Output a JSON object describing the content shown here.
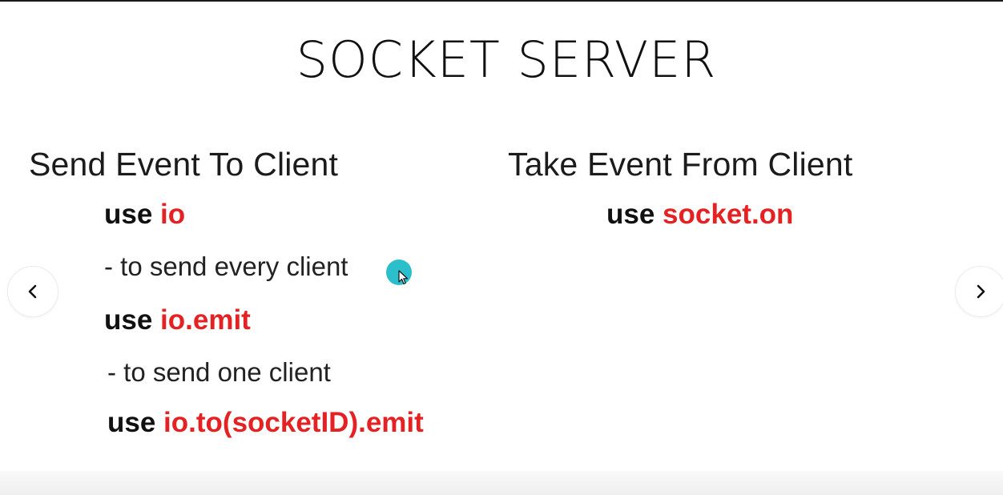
{
  "slide": {
    "title": "SOCKET SERVER",
    "left": {
      "heading": "Send Event To Client",
      "use1_kw": "use",
      "use1_code": "io",
      "note1": "- to send every client",
      "use2_kw": "use",
      "use2_code": "io.emit",
      "note2": "- to send one client",
      "use3_kw": "use",
      "use3_code": "io.to(socketID).emit"
    },
    "right": {
      "heading": "Take Event From Client",
      "use1_kw": "use",
      "use1_code": "socket.on"
    }
  },
  "nav": {
    "prev_icon": "chevron-left-icon",
    "next_icon": "chevron-right-icon"
  },
  "colors": {
    "code_red": "#e42223",
    "text_dark": "#111111",
    "cursor_teal": "#2bbfcc"
  }
}
